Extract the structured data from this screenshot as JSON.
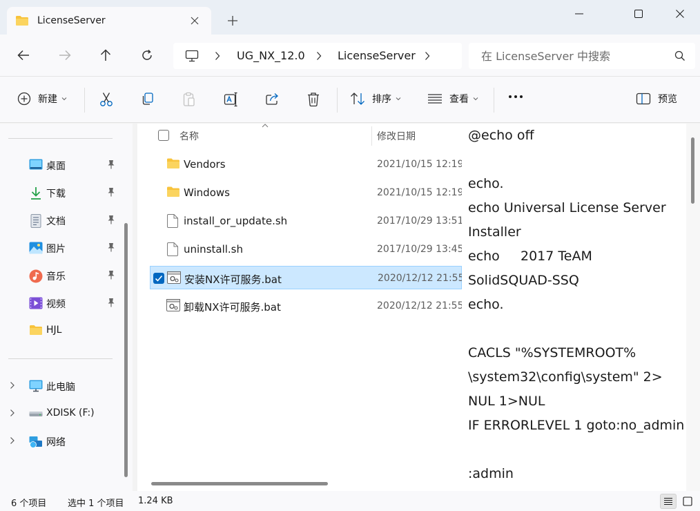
{
  "window": {
    "tab_title": "LicenseServer",
    "controls": [
      "minimize-button",
      "maximize-button",
      "close-button"
    ]
  },
  "address": {
    "breadcrumb": [
      "UG_NX_12.0",
      "LicenseServer"
    ]
  },
  "search": {
    "placeholder": "在 LicenseServer 中搜索"
  },
  "toolbar": {
    "new_label": "新建",
    "sort_label": "排序",
    "view_label": "查看",
    "more_label": "•••",
    "preview_label": "预览"
  },
  "sidebar": {
    "quick_access": [
      {
        "label": "桌面",
        "icon": "desktop-icon",
        "pinned": true
      },
      {
        "label": "下载",
        "icon": "download-icon",
        "pinned": true
      },
      {
        "label": "文档",
        "icon": "document-icon",
        "pinned": true
      },
      {
        "label": "图片",
        "icon": "pictures-icon",
        "pinned": true
      },
      {
        "label": "音乐",
        "icon": "music-icon",
        "pinned": true
      },
      {
        "label": "视频",
        "icon": "video-icon",
        "pinned": true
      },
      {
        "label": "HJL",
        "icon": "folder-icon",
        "pinned": false
      }
    ],
    "locations": [
      {
        "label": "此电脑",
        "icon": "this-pc-icon"
      },
      {
        "label": "XDISK (F:)",
        "icon": "drive-icon"
      },
      {
        "label": "网络",
        "icon": "network-icon"
      }
    ]
  },
  "file_list": {
    "columns": {
      "name": "名称",
      "date": "修改日期"
    },
    "files": [
      {
        "name": "Vendors",
        "date": "2021/10/15 12:19",
        "type": "folder",
        "selected": false
      },
      {
        "name": "Windows",
        "date": "2021/10/15 12:19",
        "type": "folder",
        "selected": false
      },
      {
        "name": "install_or_update.sh",
        "date": "2017/10/29 13:51",
        "type": "file",
        "selected": false
      },
      {
        "name": "uninstall.sh",
        "date": "2017/10/29 13:45",
        "type": "file",
        "selected": false
      },
      {
        "name": "安装NX许可服务.bat",
        "date": "2020/12/12 21:55",
        "type": "bat",
        "selected": true
      },
      {
        "name": "卸载NX许可服务.bat",
        "date": "2020/12/12 21:55",
        "type": "bat",
        "selected": false
      }
    ]
  },
  "preview": {
    "lines": [
      "@echo off",
      "",
      "echo.",
      "echo Universal License Server",
      "Installer",
      "echo     2017 TeAM",
      "SolidSQUAD-SSQ",
      "echo.",
      "",
      "CACLS \"%SYSTEMROOT%",
      "\\system32\\config\\system\" 2>",
      "NUL 1>NUL",
      "IF ERRORLEVEL 1 goto:no_admin",
      "",
      ":admin"
    ]
  },
  "status": {
    "item_count": "6 个项目",
    "selection": "选中 1 个项目",
    "size": "1.24 KB"
  },
  "colors": {
    "accent": "#0067c0",
    "selection_bg": "#cce8ff",
    "folder": "#f8c33c"
  }
}
